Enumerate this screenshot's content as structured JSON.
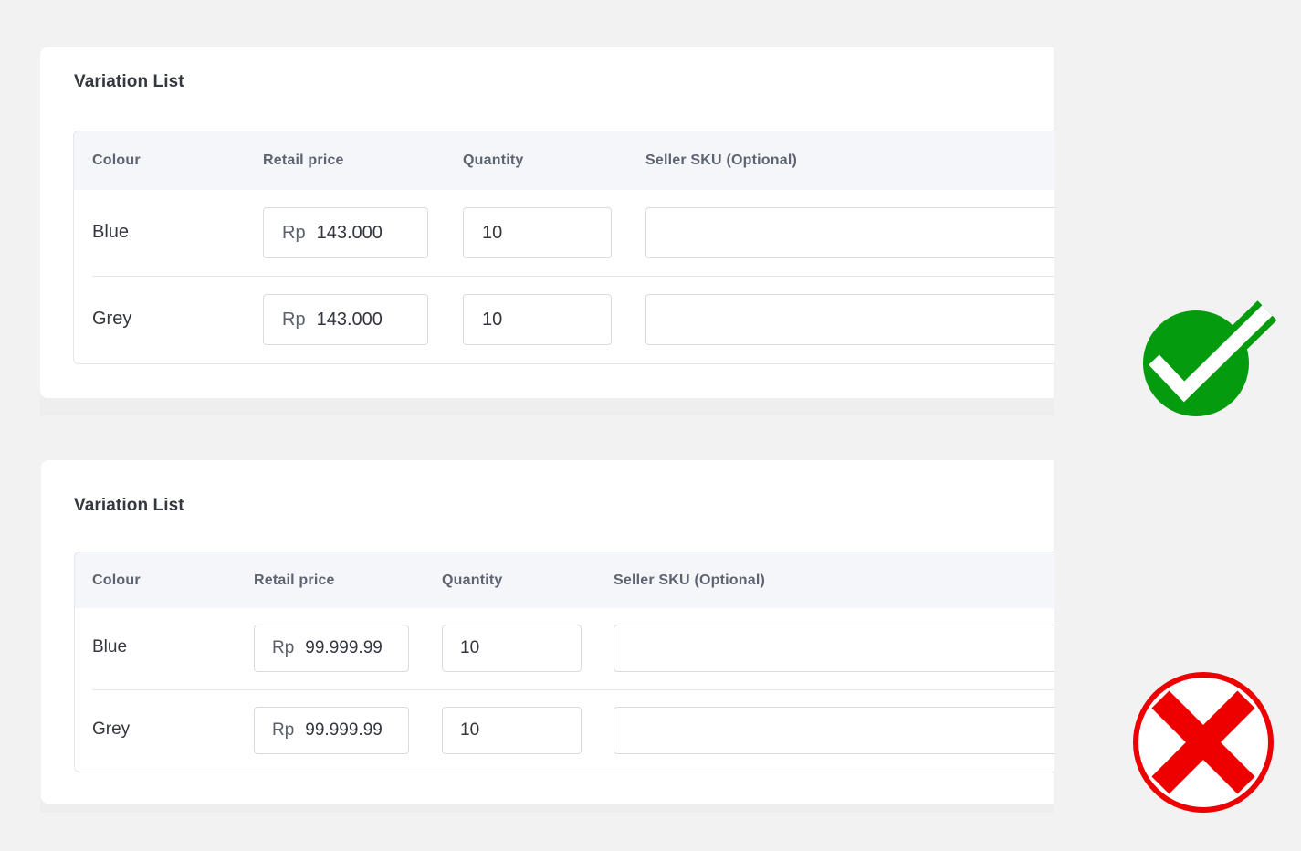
{
  "examples": [
    {
      "title": "Variation List",
      "columns": [
        "Colour",
        "Retail price",
        "Quantity",
        "Seller SKU (Optional)"
      ],
      "rows": [
        {
          "colour": "Blue",
          "price_prefix": "Rp",
          "price": "143.000",
          "quantity": "10",
          "seller_sku": ""
        },
        {
          "colour": "Grey",
          "price_prefix": "Rp",
          "price": "143.000",
          "quantity": "10",
          "seller_sku": ""
        }
      ],
      "verdict": "check-icon",
      "verdict_color": "#049b0f"
    },
    {
      "title": "Variation List",
      "columns": [
        "Colour",
        "Retail price",
        "Quantity",
        "Seller SKU (Optional)"
      ],
      "rows": [
        {
          "colour": "Blue",
          "price_prefix": "Rp",
          "price": "99.999.99",
          "quantity": "10",
          "seller_sku": ""
        },
        {
          "colour": "Grey",
          "price_prefix": "Rp",
          "price": "99.999.99",
          "quantity": "10",
          "seller_sku": ""
        }
      ],
      "verdict": "cross-icon",
      "verdict_color": "#ee0000"
    }
  ]
}
